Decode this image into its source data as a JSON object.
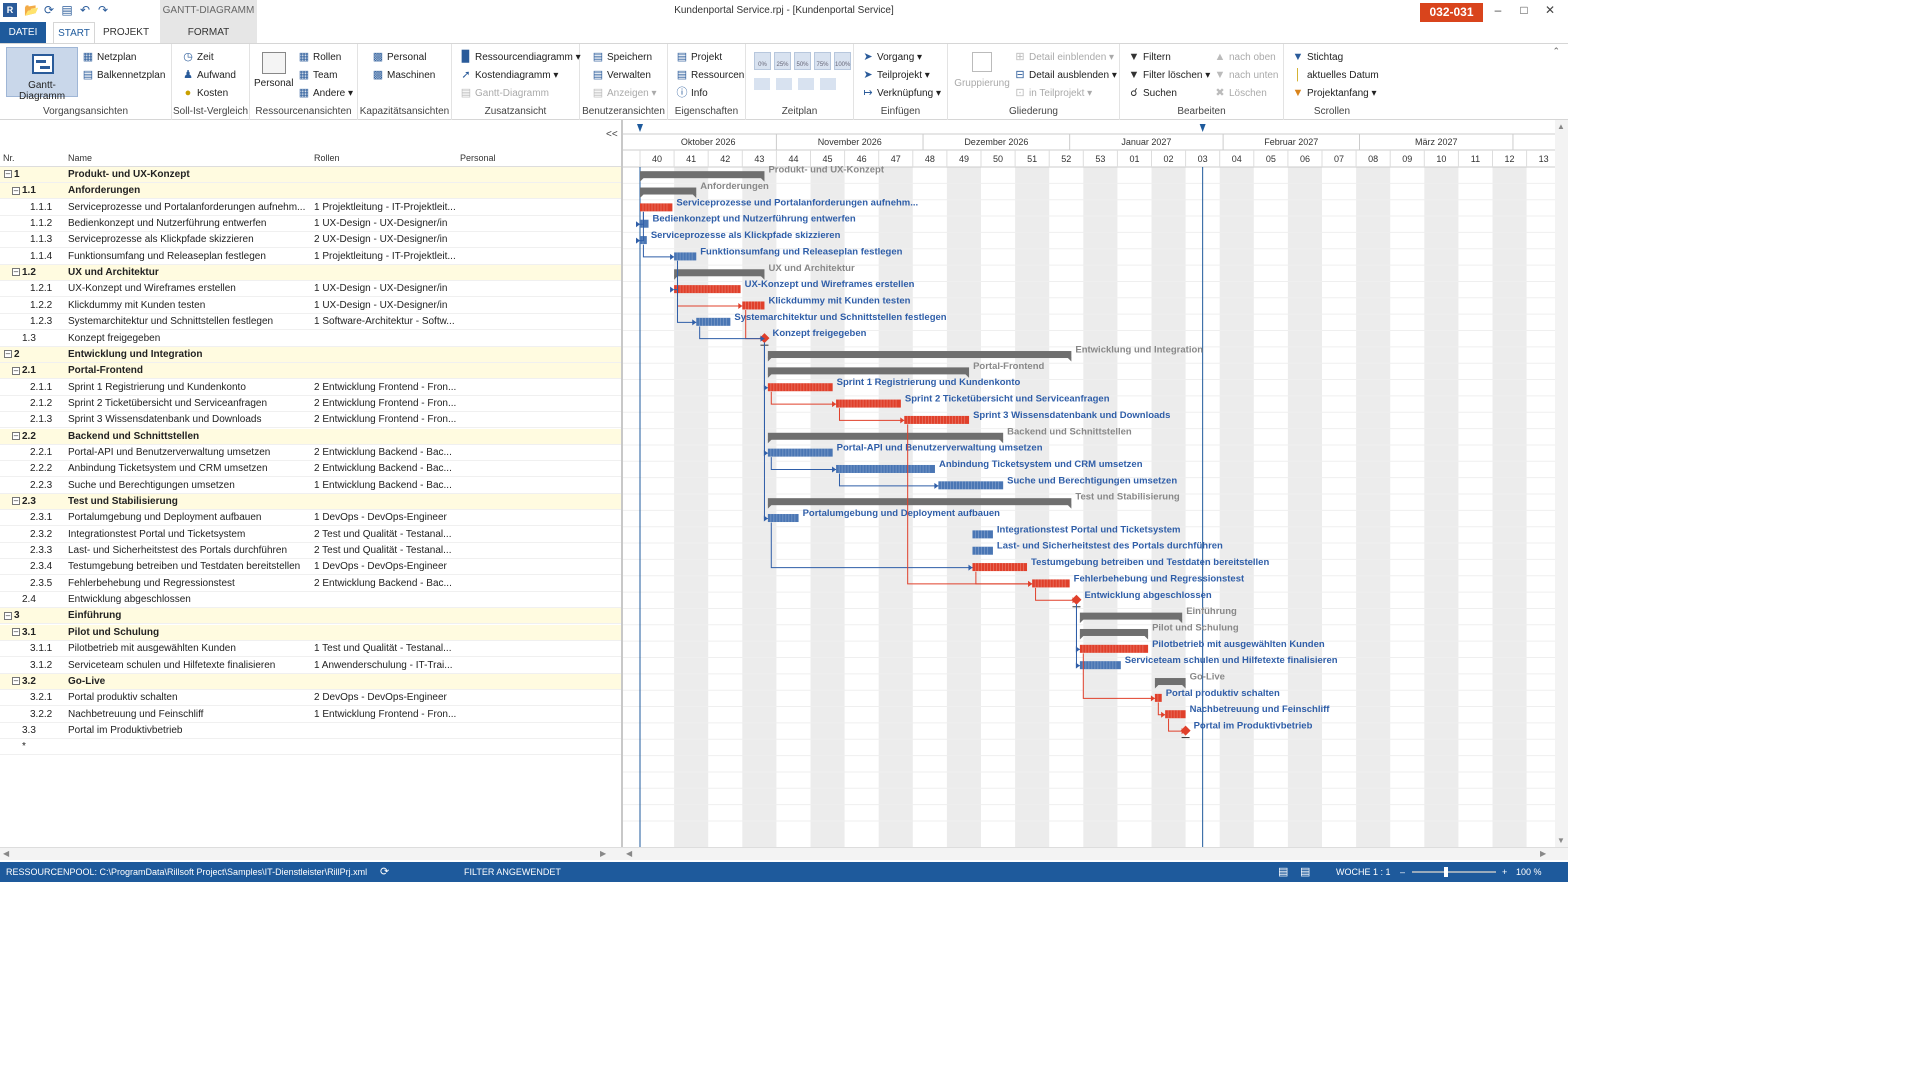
{
  "window": {
    "title": "Kundenportal Service.rpj - [Kundenportal Service]",
    "badge": "032-031",
    "context_header": "GANTT-DIAGRAMM"
  },
  "tabs": [
    "DATEI",
    "START",
    "PROJEKT",
    "FORMAT"
  ],
  "ribbon": {
    "vorgang": {
      "label": "Vorgangsansichten",
      "gantt": "Gantt-Diagramm",
      "netzplan": "Netzplan",
      "balken": "Balkennetzplan"
    },
    "sollist": {
      "label": "Soll-Ist-Vergleich",
      "zeit": "Zeit",
      "aufwand": "Aufwand",
      "kosten": "Kosten"
    },
    "ressourcen": {
      "label": "Ressourcenansichten",
      "personal": "Personal",
      "rollen": "Rollen",
      "team": "Team",
      "andere": "Andere"
    },
    "kapazitaet": {
      "label": "Kapazitätsansichten",
      "personal": "Personal",
      "maschinen": "Maschinen"
    },
    "zusatz": {
      "label": "Zusatzansicht",
      "ressdiag": "Ressourcendiagramm",
      "kostendiag": "Kostendiagramm",
      "gantt": "Gantt-Diagramm"
    },
    "benutzer": {
      "label": "Benutzeransichten",
      "speichern": "Speichern",
      "verwalten": "Verwalten",
      "anzeigen": "Anzeigen"
    },
    "eigenschaften": {
      "label": "Eigenschaften",
      "projekt": "Projekt",
      "ressourcen": "Ressourcen",
      "info": "Info"
    },
    "zeitplan": {
      "label": "Zeitplan",
      "pcts": [
        "0%",
        "25%",
        "50%",
        "75%",
        "100%"
      ]
    },
    "einfuegen": {
      "label": "Einfügen",
      "vorgang": "Vorgang",
      "teilprojekt": "Teilprojekt",
      "verkn": "Verknüpfung"
    },
    "gliederung": {
      "label": "Gliederung",
      "gruppierung": "Gruppierung",
      "einblenden": "Detail einblenden",
      "ausblenden": "Detail ausblenden",
      "inteil": "in Teilprojekt"
    },
    "bearbeiten": {
      "label": "Bearbeiten",
      "filtern": "Filtern",
      "filterloeschen": "Filter löschen",
      "suchen": "Suchen",
      "nachoben": "nach oben",
      "nachunten": "nach unten",
      "loeschen": "Löschen"
    },
    "scrollen": {
      "label": "Scrollen",
      "stichtag": "Stichtag",
      "aktuell": "aktuelles Datum",
      "projektanfang": "Projektanfang"
    }
  },
  "table": {
    "headers": {
      "nr": "Nr.",
      "name": "Name",
      "rollen": "Rollen",
      "personal": "Personal"
    },
    "rows": [
      {
        "nr": "1",
        "name": "Produkt- und UX-Konzept",
        "rolle": "",
        "lvl": 0,
        "sum": true
      },
      {
        "nr": "1.1",
        "name": "Anforderungen",
        "rolle": "",
        "lvl": 1,
        "sum": true
      },
      {
        "nr": "1.1.1",
        "name": "Serviceprozesse und Portalanforderungen aufnehm...",
        "rolle": "1 Projektleitung - IT-Projektleit...",
        "lvl": 2
      },
      {
        "nr": "1.1.2",
        "name": "Bedienkonzept und Nutzerführung entwerfen",
        "rolle": "1 UX-Design - UX-Designer/in",
        "lvl": 2
      },
      {
        "nr": "1.1.3",
        "name": "Serviceprozesse als Klickpfade skizzieren",
        "rolle": "2 UX-Design - UX-Designer/in",
        "lvl": 2
      },
      {
        "nr": "1.1.4",
        "name": "Funktionsumfang und Releaseplan festlegen",
        "rolle": "1 Projektleitung - IT-Projektleit...",
        "lvl": 2
      },
      {
        "nr": "1.2",
        "name": "UX und Architektur",
        "rolle": "",
        "lvl": 1,
        "sum": true
      },
      {
        "nr": "1.2.1",
        "name": "UX-Konzept und Wireframes erstellen",
        "rolle": "1 UX-Design - UX-Designer/in",
        "lvl": 2
      },
      {
        "nr": "1.2.2",
        "name": "Klickdummy mit Kunden testen",
        "rolle": "1 UX-Design - UX-Designer/in",
        "lvl": 2
      },
      {
        "nr": "1.2.3",
        "name": "Systemarchitektur und Schnittstellen festlegen",
        "rolle": "1 Software-Architektur - Softw...",
        "lvl": 2
      },
      {
        "nr": "1.3",
        "name": "Konzept freigegeben",
        "rolle": "",
        "lvl": 1
      },
      {
        "nr": "2",
        "name": "Entwicklung und Integration",
        "rolle": "",
        "lvl": 0,
        "sum": true
      },
      {
        "nr": "2.1",
        "name": "Portal-Frontend",
        "rolle": "",
        "lvl": 1,
        "sum": true
      },
      {
        "nr": "2.1.1",
        "name": "Sprint 1 Registrierung und Kundenkonto",
        "rolle": "2 Entwicklung Frontend - Fron...",
        "lvl": 2
      },
      {
        "nr": "2.1.2",
        "name": "Sprint 2 Ticketübersicht und Serviceanfragen",
        "rolle": "2 Entwicklung Frontend - Fron...",
        "lvl": 2
      },
      {
        "nr": "2.1.3",
        "name": "Sprint 3 Wissensdatenbank und Downloads",
        "rolle": "2 Entwicklung Frontend - Fron...",
        "lvl": 2
      },
      {
        "nr": "2.2",
        "name": "Backend und Schnittstellen",
        "rolle": "",
        "lvl": 1,
        "sum": true
      },
      {
        "nr": "2.2.1",
        "name": "Portal-API und Benutzerverwaltung umsetzen",
        "rolle": "2 Entwicklung Backend - Bac...",
        "lvl": 2
      },
      {
        "nr": "2.2.2",
        "name": "Anbindung Ticketsystem und CRM umsetzen",
        "rolle": "2 Entwicklung Backend - Bac...",
        "lvl": 2
      },
      {
        "nr": "2.2.3",
        "name": "Suche und Berechtigungen umsetzen",
        "rolle": "1 Entwicklung Backend - Bac...",
        "lvl": 2
      },
      {
        "nr": "2.3",
        "name": "Test und Stabilisierung",
        "rolle": "",
        "lvl": 1,
        "sum": true
      },
      {
        "nr": "2.3.1",
        "name": "Portalumgebung und Deployment aufbauen",
        "rolle": "1 DevOps - DevOps-Engineer",
        "lvl": 2
      },
      {
        "nr": "2.3.2",
        "name": "Integrationstest Portal und Ticketsystem",
        "rolle": "2 Test und Qualität - Testanal...",
        "lvl": 2
      },
      {
        "nr": "2.3.3",
        "name": "Last- und Sicherheitstest des Portals durchführen",
        "rolle": "2 Test und Qualität - Testanal...",
        "lvl": 2
      },
      {
        "nr": "2.3.4",
        "name": "Testumgebung betreiben und Testdaten bereitstellen",
        "rolle": "1 DevOps - DevOps-Engineer",
        "lvl": 2
      },
      {
        "nr": "2.3.5",
        "name": "Fehlerbehebung und Regressionstest",
        "rolle": "2 Entwicklung Backend - Bac...",
        "lvl": 2
      },
      {
        "nr": "2.4",
        "name": "Entwicklung abgeschlossen",
        "rolle": "",
        "lvl": 1
      },
      {
        "nr": "3",
        "name": "Einführung",
        "rolle": "",
        "lvl": 0,
        "sum": true
      },
      {
        "nr": "3.1",
        "name": "Pilot und Schulung",
        "rolle": "",
        "lvl": 1,
        "sum": true
      },
      {
        "nr": "3.1.1",
        "name": "Pilotbetrieb mit ausgewählten Kunden",
        "rolle": "1 Test und Qualität - Testanal...",
        "lvl": 2
      },
      {
        "nr": "3.1.2",
        "name": "Serviceteam schulen und Hilfetexte finalisieren",
        "rolle": "1 Anwenderschulung - IT-Trai...",
        "lvl": 2
      },
      {
        "nr": "3.2",
        "name": "Go-Live",
        "rolle": "",
        "lvl": 1,
        "sum": true
      },
      {
        "nr": "3.2.1",
        "name": "Portal produktiv schalten",
        "rolle": "2 DevOps - DevOps-Engineer",
        "lvl": 2
      },
      {
        "nr": "3.2.2",
        "name": "Nachbetreuung und Feinschliff",
        "rolle": "1 Entwicklung Frontend - Fron...",
        "lvl": 2
      },
      {
        "nr": "3.3",
        "name": "Portal im Produktivbetrieb",
        "rolle": "",
        "lvl": 1
      },
      {
        "nr": "*",
        "name": "",
        "rolle": "",
        "lvl": 1,
        "sum": false
      }
    ]
  },
  "timeline": {
    "months": [
      "Oktober 2026",
      "November 2026",
      "Dezember 2026",
      "Januar 2027",
      "Februar 2027",
      "März 2027"
    ],
    "weeks": [
      "40",
      "41",
      "42",
      "43",
      "44",
      "45",
      "46",
      "47",
      "48",
      "49",
      "50",
      "51",
      "52",
      "53",
      "01",
      "02",
      "03",
      "04",
      "05",
      "06",
      "07",
      "08",
      "09",
      "10",
      "11",
      "12",
      "13"
    ],
    "month_weeks": [
      4.0,
      4.3,
      4.3,
      4.5,
      4.0,
      4.5
    ],
    "today_week": 16.5,
    "colors": {
      "critical": "#e0402b",
      "normal": "#4a76b4",
      "summary": "#6f6f6f",
      "label": "#2f5ea8",
      "summary_label": "#888888",
      "milestone": "#e0402b"
    },
    "bars": [
      {
        "type": "summary",
        "start": 0,
        "end": 3.65
      },
      {
        "type": "summary",
        "start": 0,
        "end": 1.65
      },
      {
        "type": "critical",
        "start": 0,
        "end": 0.95
      },
      {
        "type": "normal",
        "start": 0,
        "end": 0.25
      },
      {
        "type": "normal",
        "start": 0,
        "end": 0.2
      },
      {
        "type": "normal",
        "start": 1,
        "end": 1.65
      },
      {
        "type": "summary",
        "start": 1,
        "end": 3.65
      },
      {
        "type": "critical",
        "start": 1,
        "end": 2.95
      },
      {
        "type": "critical",
        "start": 3,
        "end": 3.65
      },
      {
        "type": "normal",
        "start": 1.65,
        "end": 2.65
      },
      {
        "type": "milestone",
        "start": 3.65,
        "end": 3.65
      },
      {
        "type": "summary",
        "start": 3.75,
        "end": 12.65
      },
      {
        "type": "summary",
        "start": 3.75,
        "end": 9.65
      },
      {
        "type": "critical",
        "start": 3.75,
        "end": 5.65
      },
      {
        "type": "critical",
        "start": 5.75,
        "end": 7.65
      },
      {
        "type": "critical",
        "start": 7.75,
        "end": 9.65
      },
      {
        "type": "summary",
        "start": 3.75,
        "end": 10.65
      },
      {
        "type": "normal",
        "start": 3.75,
        "end": 5.65
      },
      {
        "type": "normal",
        "start": 5.75,
        "end": 8.65
      },
      {
        "type": "normal",
        "start": 8.75,
        "end": 10.65
      },
      {
        "type": "summary",
        "start": 3.75,
        "end": 12.65
      },
      {
        "type": "normal",
        "start": 3.75,
        "end": 4.65
      },
      {
        "type": "normal",
        "start": 9.75,
        "end": 10.35
      },
      {
        "type": "normal",
        "start": 9.75,
        "end": 10.35
      },
      {
        "type": "critical",
        "start": 9.75,
        "end": 11.35
      },
      {
        "type": "critical",
        "start": 11.5,
        "end": 12.6
      },
      {
        "type": "milestone",
        "start": 12.8,
        "end": 12.8
      },
      {
        "type": "summary",
        "start": 12.9,
        "end": 15.9
      },
      {
        "type": "summary",
        "start": 12.9,
        "end": 14.9
      },
      {
        "type": "critical",
        "start": 12.9,
        "end": 14.9
      },
      {
        "type": "normal",
        "start": 12.9,
        "end": 14.1
      },
      {
        "type": "summary",
        "start": 15.1,
        "end": 16.0
      },
      {
        "type": "critical",
        "start": 15.1,
        "end": 15.3
      },
      {
        "type": "critical",
        "start": 15.4,
        "end": 16.0
      },
      {
        "type": "milestone",
        "start": 16.0,
        "end": 16.0
      }
    ]
  },
  "status": {
    "pool": "RESSOURCENPOOL: C:\\ProgramData\\Rillsoft Project\\Samples\\IT-Dienstleister\\RillPrj.xml",
    "filter": "FILTER ANGEWENDET",
    "woche": "WOCHE 1 : 1",
    "zoom": "100 %"
  }
}
